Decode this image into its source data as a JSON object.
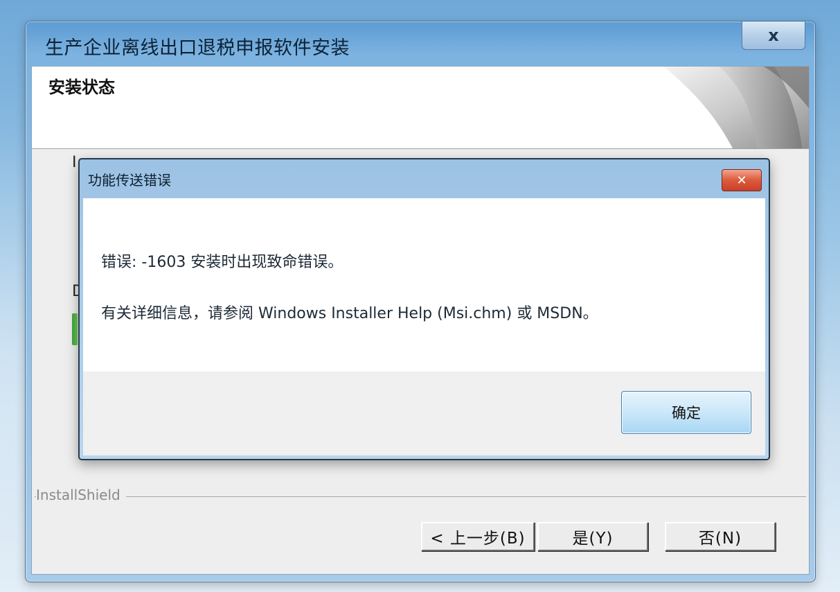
{
  "installer_window": {
    "title": "生产企业离线出口退税申报软件安装",
    "close_glyph": "x",
    "banner_title": "安装状态",
    "left_fragments": [
      "I",
      "D"
    ],
    "installshield_label": "InstallShield",
    "buttons": {
      "back_label": "< 上一步(B)",
      "yes_label": "是(Y)",
      "no_label": "否(N)"
    }
  },
  "error_dialog": {
    "title": "功能传送错误",
    "close_glyph": "✕",
    "message_line1": "错误: -1603  安装时出现致命错误。",
    "message_line2": "有关详细信息，请参阅 Windows Installer Help (Msi.chm) 或 MSDN。",
    "ok_label": "确定"
  },
  "colors": {
    "title_bar": "#7db3e0",
    "dialog_close": "#de5a3c",
    "ok_button": "#cbe7f9"
  }
}
